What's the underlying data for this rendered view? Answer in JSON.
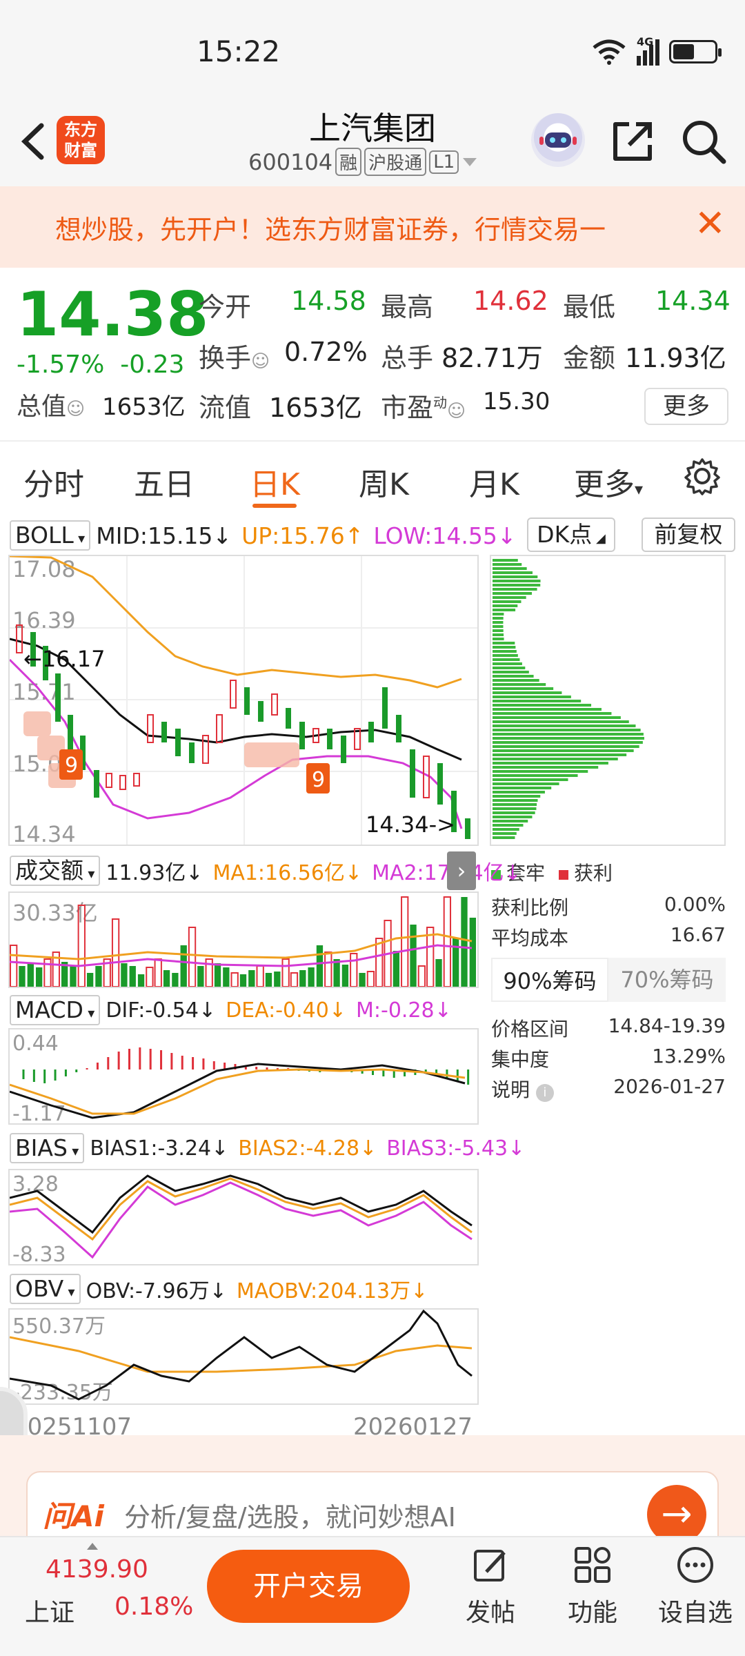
{
  "status": {
    "time": "15:22",
    "network": "4G"
  },
  "header": {
    "logo_text": "东方\n财富",
    "stock_name": "上汽集团",
    "stock_code": "600104",
    "tags": [
      "融",
      "沪股通",
      "L1"
    ]
  },
  "banner": {
    "text": "想炒股，先开户！选东方财富证券，行情交易一"
  },
  "quote": {
    "price": "14.38",
    "change_pct": "-1.57%",
    "change": "-0.23",
    "open_label": "今开",
    "open": "14.58",
    "high_label": "最高",
    "high": "14.62",
    "low_label": "最低",
    "low": "14.34",
    "turnover_label": "换手",
    "turnover": "0.72%",
    "volume_label": "总手",
    "volume": "82.71万",
    "amount_label": "金额",
    "amount": "11.93亿",
    "mcap_label": "总值",
    "mcap": "1653亿",
    "float_label": "流值",
    "float": "1653亿",
    "pe_label": "市盈",
    "pe_sup": "动",
    "pe": "15.30",
    "more_label": "更多"
  },
  "tabs": [
    "分时",
    "五日",
    "日K",
    "周K",
    "月K",
    "更多"
  ],
  "active_tab": "日K",
  "boll": {
    "selector": "BOLL",
    "mid": "MID:15.15↓",
    "up": "UP:15.76↑",
    "low": "LOW:14.55↓",
    "dk_label": "DK点",
    "fq_label": "前复权",
    "y_labels": [
      "17.08",
      "16.39",
      "15.71",
      "15.02",
      "14.34"
    ],
    "marker_high": "16.17",
    "marker_last": "14.34"
  },
  "volume": {
    "selector": "成交额",
    "val": "11.93亿↓",
    "ma1": "MA1:16.56亿↓",
    "ma2": "MA2:17.44亿↓",
    "y_label": "30.33亿"
  },
  "macd": {
    "selector": "MACD",
    "dif": "DIF:-0.54↓",
    "dea": "DEA:-0.40↓",
    "m": "M:-0.28↓",
    "y_top": "0.44",
    "y_bottom": "-1.17"
  },
  "bias": {
    "selector": "BIAS",
    "b1": "BIAS1:-3.24↓",
    "b2": "BIAS2:-4.28↓",
    "b3": "BIAS3:-5.43↓",
    "y_top": "3.28",
    "y_bottom": "-8.33"
  },
  "obv": {
    "selector": "OBV",
    "obv": "OBV:-7.96万↓",
    "maobv": "MAOBV:204.13万↓",
    "y_top": "550.37万",
    "y_bottom": "-233.35万"
  },
  "x_axis": {
    "start": "20251107",
    "end": "20260127"
  },
  "chip_panel": {
    "legend_trapped": "套牢",
    "legend_profit": "获利",
    "profit_ratio_label": "获利比例",
    "profit_ratio": "0.00%",
    "avg_cost_label": "平均成本",
    "avg_cost": "16.67",
    "tab_90": "90%筹码",
    "tab_70": "70%筹码",
    "range_label": "价格区间",
    "range": "14.84-19.39",
    "concentration_label": "集中度",
    "concentration": "13.29%",
    "note_label": "说明",
    "note_date": "2026-01-27"
  },
  "ai": {
    "logo": "问Ai",
    "placeholder": "分析/复盘/选股，就问妙想AI"
  },
  "bottom": {
    "index_value": "4139.90",
    "index_name": "上证",
    "index_pct": "0.18%",
    "trade_label": "开户交易",
    "nav": [
      "发帖",
      "功能",
      "设自选"
    ]
  },
  "colors": {
    "up": "#e0303a",
    "down": "#1a9a2a",
    "accent": "#f0681a",
    "mid_line": "#111111",
    "up_band": "#f0a020",
    "low_band": "#d43ad6"
  },
  "chart_data": [
    {
      "type": "line",
      "title": "BOLL",
      "x": [
        "20251107",
        "20260127"
      ],
      "series": [
        {
          "name": "MID",
          "values": [
            15.15
          ]
        },
        {
          "name": "UP",
          "values": [
            15.76
          ]
        },
        {
          "name": "LOW",
          "values": [
            14.55
          ]
        }
      ],
      "ylim": [
        14.34,
        17.08
      ]
    }
  ]
}
